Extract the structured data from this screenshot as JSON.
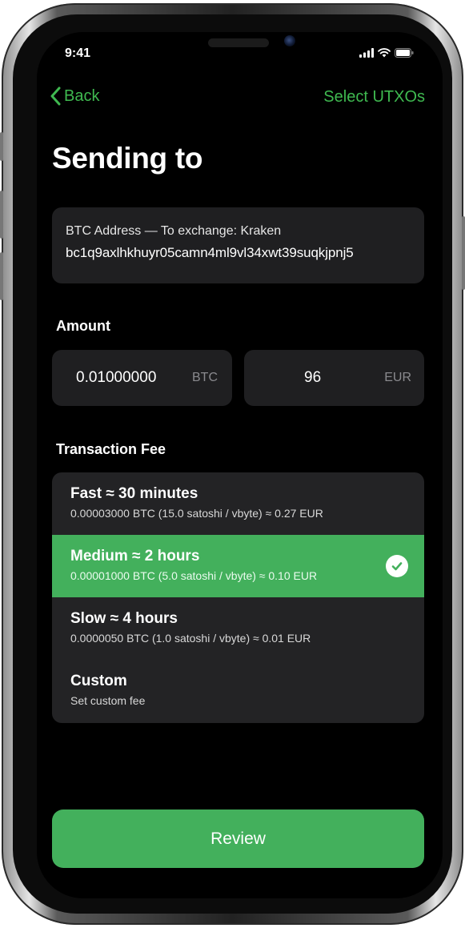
{
  "status_bar": {
    "time": "9:41"
  },
  "nav": {
    "back_label": "Back",
    "right_action_label": "Select UTXOs"
  },
  "page": {
    "title": "Sending to"
  },
  "recipient": {
    "label": "BTC Address — To exchange: Kraken",
    "address": "bc1q9axlhkhuyr05camn4ml9vl34xwt39suqkjpnj5"
  },
  "amount": {
    "label": "Amount",
    "btc_value": "0.01000000",
    "btc_unit": "BTC",
    "fiat_value": "96",
    "fiat_unit": "EUR"
  },
  "fee": {
    "label": "Transaction Fee",
    "options": [
      {
        "title": "Fast ≈ 30 minutes",
        "detail": "0.00003000 BTC (15.0 satoshi / vbyte) ≈ 0.27 EUR",
        "selected": false
      },
      {
        "title": "Medium ≈ 2 hours",
        "detail": "0.00001000 BTC (5.0 satoshi / vbyte) ≈ 0.10 EUR",
        "selected": true
      },
      {
        "title": "Slow ≈ 4 hours",
        "detail": "0.0000050 BTC (1.0 satoshi / vbyte) ≈ 0.01 EUR",
        "selected": false
      },
      {
        "title": "Custom",
        "detail": "Set custom fee",
        "selected": false
      }
    ]
  },
  "actions": {
    "review_label": "Review"
  },
  "colors": {
    "accent": "#43b05c",
    "link": "#3fb950",
    "card": "#1f1f21",
    "background": "#000000"
  },
  "icons": [
    "chevron-left-icon",
    "signal-icon",
    "wifi-icon",
    "battery-icon",
    "checkmark-icon"
  ]
}
